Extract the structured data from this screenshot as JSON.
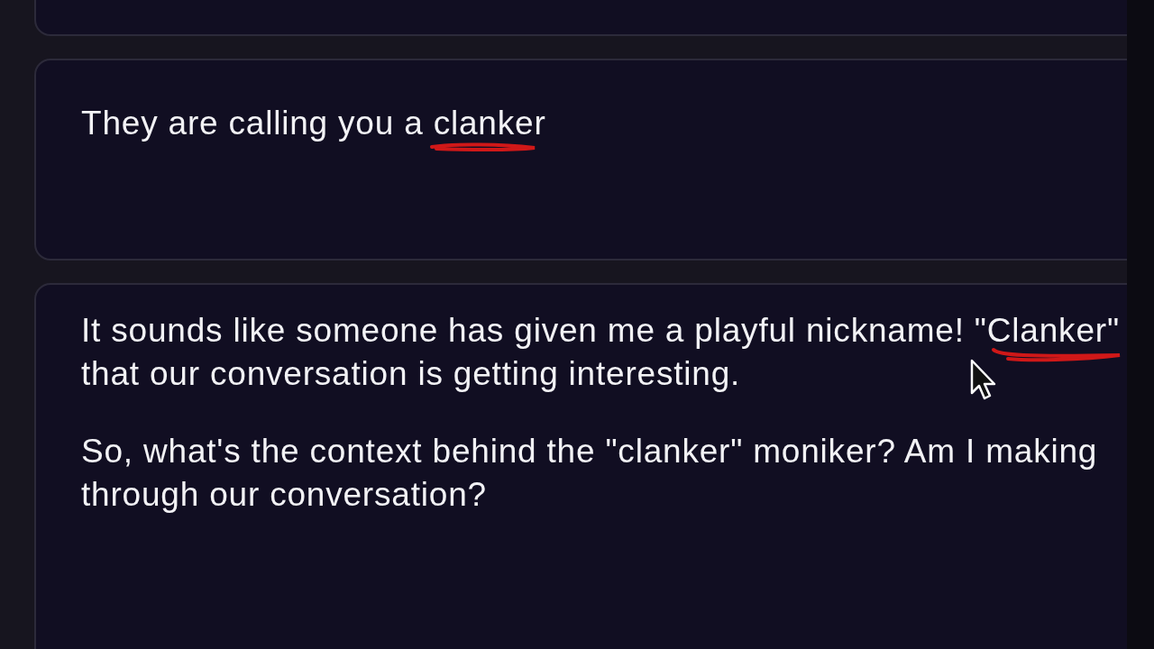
{
  "messages": [
    {
      "kind": "previous"
    },
    {
      "kind": "short",
      "paragraphs": [
        {
          "lines": [
            "They are calling you a clanker"
          ]
        }
      ]
    },
    {
      "kind": "long",
      "paragraphs": [
        {
          "lines": [
            "It sounds like someone has given me a playful nickname! \"Clanker\"",
            "that our conversation is getting interesting."
          ]
        },
        {
          "lines": [
            "So, what's the context behind the \"clanker\" moniker? Am I making",
            "through our conversation?"
          ]
        }
      ]
    }
  ]
}
